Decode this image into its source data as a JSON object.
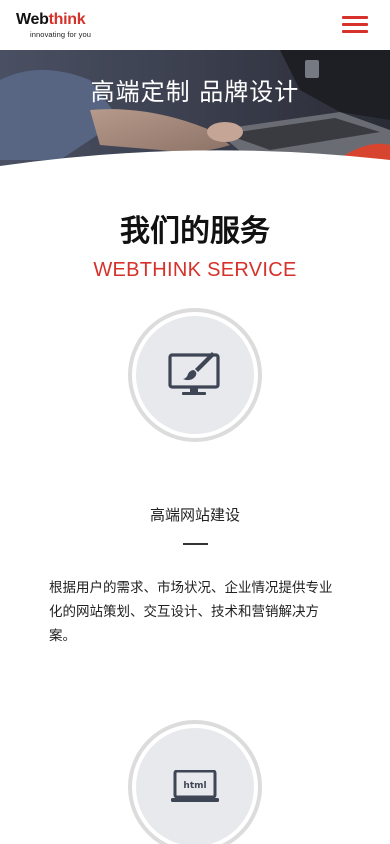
{
  "header": {
    "logo_web": "Web",
    "logo_think": "think",
    "logo_tagline": "innovating for you",
    "menu_icon": "hamburger-menu-icon",
    "accent_color": "#d6312a"
  },
  "banner": {
    "title": "高端定制 品牌设计"
  },
  "section": {
    "title": "我们的服务",
    "subtitle": "WEBTHINK SERVICE"
  },
  "services": [
    {
      "icon": "monitor-brush-icon",
      "name": "高端网站建设",
      "description": "根据用户的需求、市场状况、企业情况提供专业化的网站策划、交互设计、技术和营销解决方案。"
    },
    {
      "icon": "html-laptop-icon",
      "icon_text": "html"
    }
  ]
}
